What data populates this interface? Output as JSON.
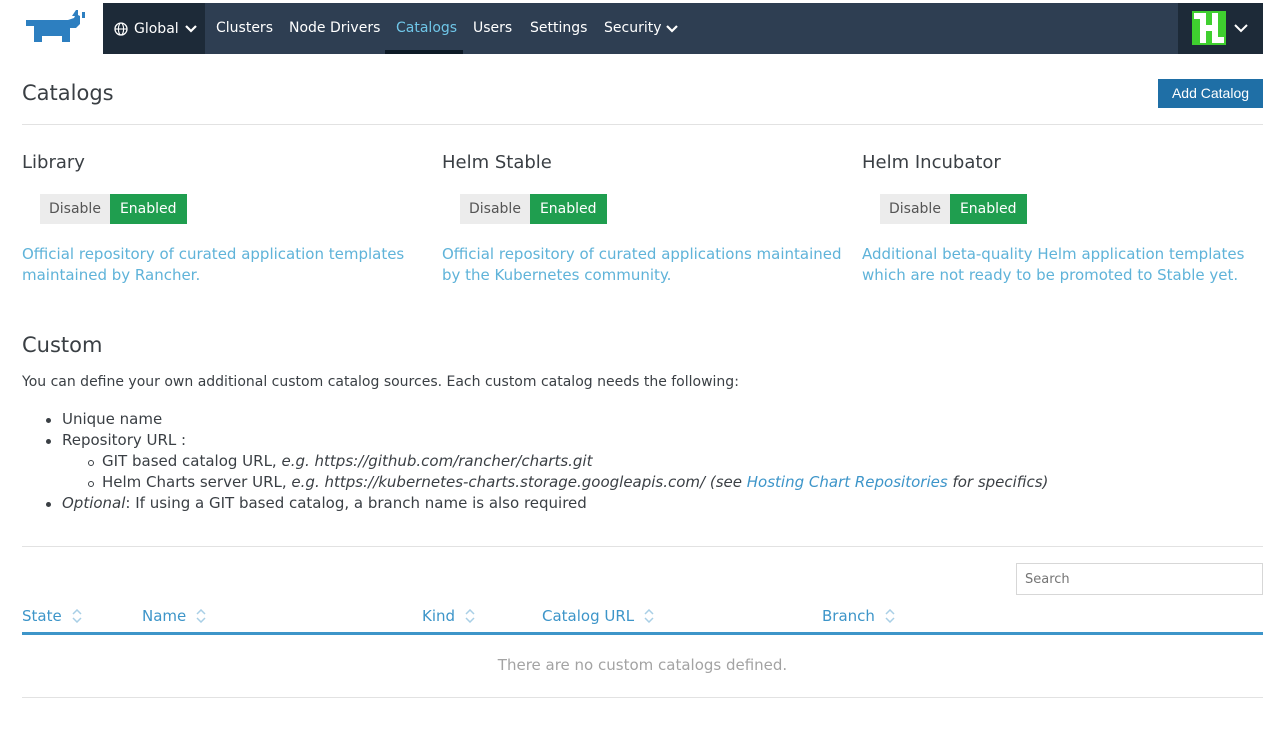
{
  "nav": {
    "global_label": "Global",
    "items": [
      {
        "label": "Clusters"
      },
      {
        "label": "Node Drivers"
      },
      {
        "label": "Catalogs",
        "active": true
      },
      {
        "label": "Users"
      },
      {
        "label": "Settings"
      },
      {
        "label": "Security"
      }
    ]
  },
  "page": {
    "title": "Catalogs",
    "add_button": "Add Catalog"
  },
  "catalogs": [
    {
      "name": "Library",
      "disable_label": "Disable",
      "enabled_label": "Enabled",
      "desc_line1": "Official repository of curated application templates",
      "desc_line2": "maintained by Rancher."
    },
    {
      "name": "Helm Stable",
      "disable_label": "Disable",
      "enabled_label": "Enabled",
      "desc_line1": "Official repository of curated applications maintained",
      "desc_line2": "by the Kubernetes community."
    },
    {
      "name": "Helm Incubator",
      "disable_label": "Disable",
      "enabled_label": "Enabled",
      "desc_line1": "Additional beta-quality Helm application templates",
      "desc_line2": "which are not ready to be promoted to Stable yet."
    }
  ],
  "custom": {
    "title": "Custom",
    "intro": "You can define your own additional custom catalog sources. Each custom catalog needs the following:",
    "req_name": "Unique name",
    "req_repo": "Repository URL :",
    "git_label": "GIT based catalog URL,",
    "git_example": "e.g. https://github.com/rancher/charts.git",
    "helm_label": "Helm Charts server URL,",
    "helm_example": "e.g. https://kubernetes-charts.storage.googleapis.com/ (see",
    "helm_link": "Hosting Chart Repositories",
    "helm_suffix": "for specifics)",
    "optional_label": "Optional",
    "optional_text": ": If using a GIT based catalog, a branch name is also required"
  },
  "table": {
    "search_placeholder": "Search",
    "columns": [
      "State",
      "Name",
      "Kind",
      "Catalog URL",
      "Branch"
    ],
    "empty_text": "There are no custom catalogs defined."
  },
  "colors": {
    "nav_bg": "#2e3e52",
    "accent": "#3d95c9",
    "enabled": "#1f9e4f",
    "button": "#1f6fa6"
  }
}
